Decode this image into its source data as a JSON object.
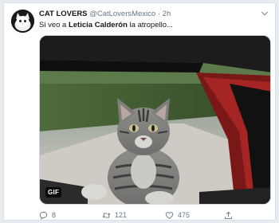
{
  "tweet": {
    "author_name": "CAT LOVERS",
    "handle": "@CatLoversMexico",
    "separator": "·",
    "time": "2h",
    "text_before": "Si veo a ",
    "text_bold": "Leticia Calderón",
    "text_after": " la atropello...",
    "media_badge": "GIF"
  },
  "actions": {
    "reply_count": "8",
    "retweet_count": "121",
    "like_count": "475"
  },
  "icons": {
    "avatar": "cat-avatar-icon",
    "menu": "chevron-down-icon",
    "reply": "reply-icon",
    "retweet": "retweet-icon",
    "like": "heart-icon",
    "share": "share-icon"
  },
  "colors": {
    "background": "#e6ecf0",
    "text": "#14171a",
    "muted": "#657786"
  }
}
